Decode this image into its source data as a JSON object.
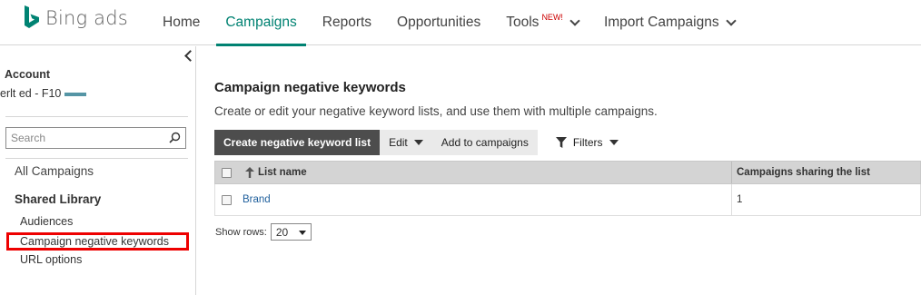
{
  "brand": {
    "name": "Bing ads",
    "color": "#008373"
  },
  "nav": {
    "items": [
      {
        "label": "Home",
        "active": false
      },
      {
        "label": "Campaigns",
        "active": true
      },
      {
        "label": "Reports",
        "active": false
      },
      {
        "label": "Opportunities",
        "active": false
      },
      {
        "label": "Tools",
        "badge": "NEW!",
        "active": false
      },
      {
        "label": "Import Campaigns",
        "active": false
      }
    ]
  },
  "sidebar": {
    "account_label": "Account",
    "account_name": "erlt ed - F10",
    "search_placeholder": "Search",
    "all_campaigns": "All Campaigns",
    "shared_library_heading": "Shared Library",
    "shared_items": [
      {
        "label": "Audiences"
      },
      {
        "label": "Campaign negative keywords",
        "highlighted": true
      },
      {
        "label": "URL options"
      }
    ]
  },
  "main": {
    "title": "Campaign negative keywords",
    "description": "Create or edit your negative keyword lists, and use them with multiple campaigns.",
    "toolbar": {
      "create_label": "Create negative keyword list",
      "edit_label": "Edit",
      "add_label": "Add to campaigns",
      "filters_label": "Filters"
    },
    "table": {
      "columns": [
        "List name",
        "Campaigns sharing the list"
      ],
      "rows": [
        {
          "name": "Brand",
          "sharing": "1"
        }
      ]
    },
    "show_rows_label": "Show rows:",
    "show_rows_value": "20"
  },
  "colors": {
    "accent": "#008272",
    "highlight_box": "#e00000",
    "link": "#1f5f9c"
  }
}
